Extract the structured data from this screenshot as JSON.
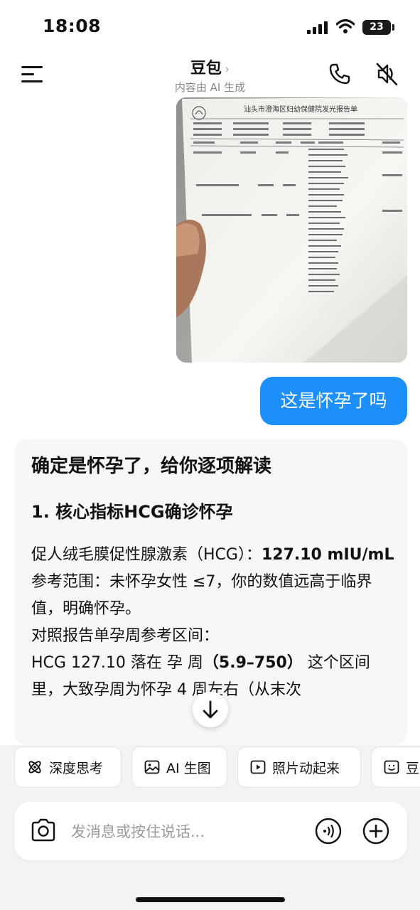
{
  "status_bar": {
    "time": "18:08",
    "battery": "23"
  },
  "header": {
    "title": "豆包",
    "subtitle": "内容由 AI 生成"
  },
  "report_image": {
    "title": "汕头市澄海区妇幼保健院发光报告单"
  },
  "user_message": "这是怀孕了吗",
  "reply": {
    "heading": "确定是怀孕了，给你逐项解读",
    "section_title": "1. 核心指标HCG确诊怀孕",
    "p1_text": "促人绒毛膜促性腺激素（HCG）：",
    "p1_value": "127.10 mIU/mL",
    "p2": "参考范围：未怀孕女性 ≤7，你的数值远高于临界值，明确怀孕。",
    "p3": "对照报告单孕周参考区间：",
    "p4_a": "HCG 127.10 落在 孕 ",
    "p4_b": "周",
    "p4_bold": "（5.9–750）",
    "p4_c": " 这个区间里，大致孕周为怀孕 4 周左右（从末次"
  },
  "quick_actions": [
    {
      "label": "深度思考",
      "icon": "atom-icon"
    },
    {
      "label": "AI 生图",
      "icon": "image-icon"
    },
    {
      "label": "照片动起来",
      "icon": "play-icon"
    },
    {
      "label": "豆",
      "icon": "photo-smile-icon"
    }
  ],
  "input": {
    "placeholder": "发消息或按住说话..."
  }
}
